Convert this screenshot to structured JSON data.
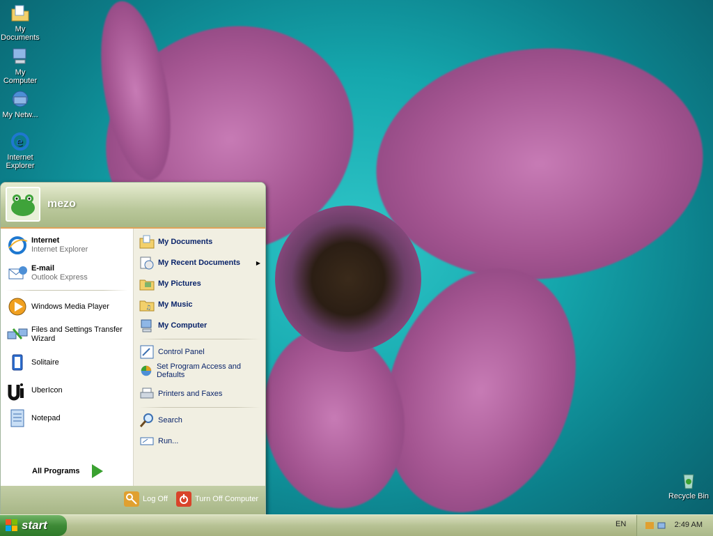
{
  "desktop": {
    "icons": [
      {
        "label": "My Documents",
        "icon": "folder-documents-icon"
      },
      {
        "label": "My Computer",
        "icon": "computer-icon"
      },
      {
        "label": "My Netw...",
        "icon": "network-icon"
      },
      {
        "label": "Internet Explorer",
        "icon": "internet-explorer-icon"
      },
      {
        "label": "Recycle Bin",
        "icon": "recycle-bin-icon"
      }
    ]
  },
  "start_menu": {
    "user": "mezo",
    "pinned": [
      {
        "title": "Internet",
        "subtitle": "Internet Explorer"
      },
      {
        "title": "E-mail",
        "subtitle": "Outlook Express"
      }
    ],
    "recent": [
      {
        "label": "Windows Media Player"
      },
      {
        "label": "Files and Settings Transfer Wizard"
      },
      {
        "label": "Solitaire"
      },
      {
        "label": "UberIcon"
      },
      {
        "label": "Notepad"
      }
    ],
    "all_programs": "All Programs",
    "places": [
      {
        "label": "My Documents"
      },
      {
        "label": "My Recent Documents"
      },
      {
        "label": "My Pictures"
      },
      {
        "label": "My Music"
      },
      {
        "label": "My Computer"
      }
    ],
    "settings": [
      {
        "label": "Control Panel"
      },
      {
        "label": "Set Program Access and Defaults"
      },
      {
        "label": "Printers and Faxes"
      }
    ],
    "tools": [
      {
        "label": "Search"
      },
      {
        "label": "Run..."
      }
    ],
    "footer": {
      "log_off": "Log Off",
      "turn_off": "Turn Off Computer"
    }
  },
  "taskbar": {
    "start_label": "start",
    "language": "EN",
    "clock": "2:49 AM"
  }
}
